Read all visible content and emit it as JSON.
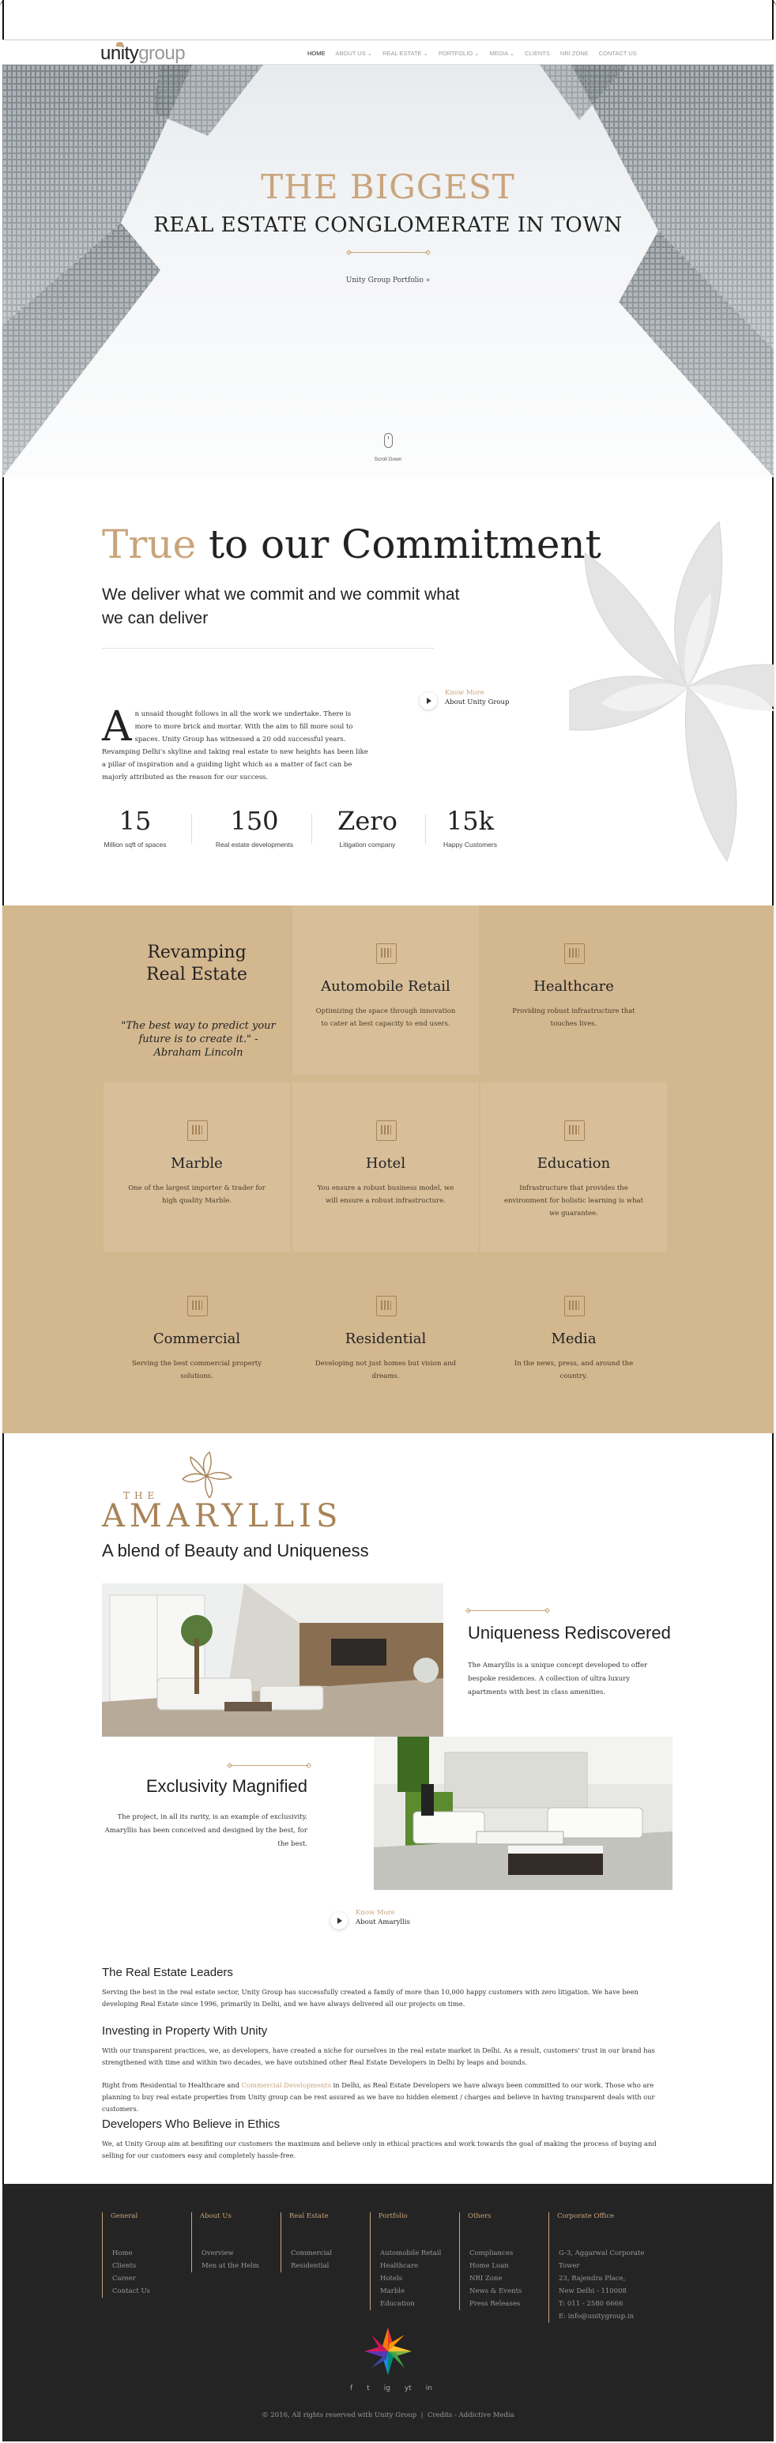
{
  "window": {
    "controls": [
      "close",
      "minimize",
      "maximize"
    ]
  },
  "nav": {
    "logo_unity": "unity",
    "logo_group": "group",
    "items": [
      "HOME",
      "ABOUT US",
      "REAL ESTATE",
      "PORTFOLIO",
      "MEDIA",
      "CLIENTS",
      "NRI ZONE",
      "CONTACT US"
    ]
  },
  "hero": {
    "title": "THE BIGGEST",
    "subtitle": "REAL ESTATE CONGLOMERATE IN TOWN",
    "link": "Unity Group Portfolio »",
    "scroll": "Scroll Down"
  },
  "commitment": {
    "title_gold": "True",
    "title_rest": "to our Commitment",
    "subtitle": "We deliver what we commit and we commit what we can deliver",
    "drop_cap": "A",
    "body": "n unsaid thought follows in all the work we undertake. There is more to more brick and mortar. With the aim to fill more soul to spaces. Unity Group has witnessed a 20 odd successful years. Revamping Delhi's skyline and taking real estate to new heights has been like a pillar of inspiration and a guiding light which as a matter of fact can be majorly attributed as the reason for our success.",
    "know_more": "Know More",
    "know_target": "About Unity Group",
    "stats": [
      {
        "value": "15",
        "label": "Million sqft of spaces"
      },
      {
        "value": "150",
        "label": "Real estate developments"
      },
      {
        "value": "Zero",
        "label": "Litigation company"
      },
      {
        "value": "15k",
        "label": "Happy Customers"
      }
    ]
  },
  "revamping": {
    "title_line1": "Revamping",
    "title_line2": "Real Estate",
    "quote": "\"The best way to predict your future is to create it.\" - Abraham Lincoln",
    "cells": [
      {
        "icon": "mall-icon",
        "title": "Automobile Retail",
        "desc": "Optimizing the space through innovation to cater at best capacity to end users."
      },
      {
        "icon": "hospital-icon",
        "title": "Healthcare",
        "desc": "Providing robust infrastructure that touches lives."
      },
      {
        "icon": "house-icon",
        "title": "Marble",
        "desc": "One of the largest importer & trader for high quality Marble."
      },
      {
        "icon": "hotel-icon",
        "title": "Hotel",
        "desc": "You ensure a robust business model, we will ensure a robust infrastructure."
      },
      {
        "icon": "school-icon",
        "title": "Education",
        "desc": "Infrastructure that provides the environment for holistic learning is what we guarantee."
      },
      {
        "icon": "office-icon",
        "title": "Commercial",
        "desc": "Serving the best commercial property solutions."
      },
      {
        "icon": "residential-icon",
        "title": "Residential",
        "desc": "Developing not just homes but vision and dreams."
      },
      {
        "icon": "media-icon",
        "title": "Media",
        "desc": "In the news, press, and around the country."
      }
    ]
  },
  "amaryllis": {
    "brand_small": "THE",
    "brand": "AMARYLLIS",
    "tagline": "A blend of Beauty and Uniqueness",
    "uniq_title": "Uniqueness Rediscovered",
    "uniq_body": "The Amaryllis is a unique concept developed to offer bespoke residences. A collection of ultra luxury apartments with best in class amenities.",
    "excl_title": "Exclusivity Magnified",
    "excl_body": "The project, in all its rarity, is an example of exclusivity. Amaryllis has been conceived and designed by the best, for the best.",
    "know_more": "Know More",
    "know_target": "About Amaryllis"
  },
  "leaders": {
    "h1": "The Real Estate Leaders",
    "p1": "Serving the best in the real estate sector, Unity Group has successfully created a family of more than 10,000 happy customers with zero litigation. We have been developing Real Estate since 1996, primarily in Delhi, and we have always delivered all our projects on time.",
    "h2": "Investing in Property With Unity",
    "p2": "With our transparent practices, we, as developers, have created a niche for ourselves in the real estate market in Delhi. As a result, customers' trust in our brand has strengthened with time and within two decades, we have outshined other Real Estate Developers in Delhi by leaps and bounds.",
    "p3_a": "Right from Residential to Healthcare and",
    "p3_link": "Commercial Developments",
    "p3_b": "in Delhi, as Real Estate Developers we have always been committed to our work. Those who are planning to buy real estate properties from Unity group can be rest assured as we have no hidden element / charges and believe in having transparent deals with our customers.",
    "h3": "Developers Who Believe in Ethics",
    "p4": "We, at Unity Group aim at benifiting our customers the maximum and believe only in ethical practices and work towards the goal of making the process of buying and selling for our customers easy and completely hassle-free."
  },
  "footer": {
    "columns": [
      {
        "title": "General",
        "links": [
          "Home",
          "Clients",
          "Career",
          "Contact Us"
        ]
      },
      {
        "title": "About Us",
        "links": [
          "Overview",
          "Men at the Helm"
        ]
      },
      {
        "title": "Real Estate",
        "links": [
          "Commercial",
          "Residential"
        ]
      },
      {
        "title": "Portfolio",
        "links": [
          "Automobile Retail",
          "Healthcare",
          "Hotels",
          "Marble",
          "Education"
        ]
      },
      {
        "title": "Others",
        "links": [
          "Compliances",
          "Home Loan",
          "NRI Zone",
          "News & Events",
          "Press Releases"
        ]
      },
      {
        "title": "Corporate Office",
        "links": [
          "G-3, Aggarwal Corporate Tower",
          "23, Rajendra Place,",
          "New Delhi - 110008",
          "T: 011 - 2580 6666",
          "E: info@unitygroup.in"
        ]
      }
    ],
    "social": [
      "f",
      "t",
      "ig",
      "yt",
      "in"
    ],
    "copyright": "© 2016, All rights reserved with Unity Group",
    "sep": "|",
    "credits": "Credits - Addictive Media"
  },
  "colors": {
    "gold": "#c9a47b",
    "tan": "#d3b78f",
    "footer": "#242424"
  }
}
